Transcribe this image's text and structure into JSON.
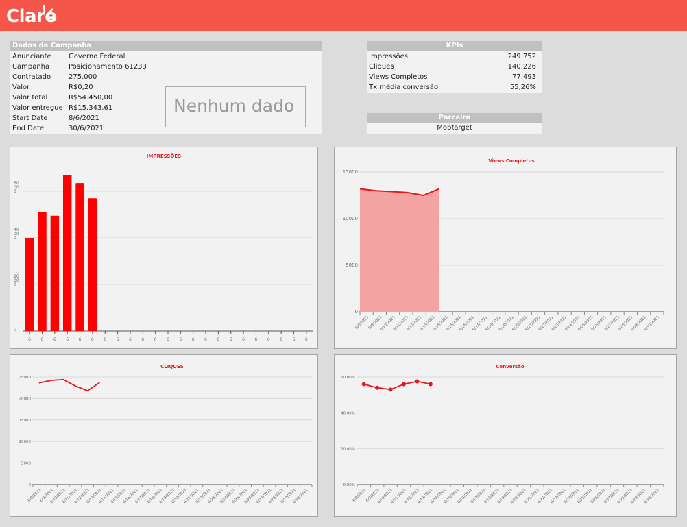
{
  "brand": {
    "name": "Claro",
    "color": "#f4564a"
  },
  "campaign": {
    "title": "Dados da Campanha",
    "rows": [
      {
        "label": "Anunciante",
        "value": "Governo Federal"
      },
      {
        "label": "Campanha",
        "value": "Posicionamento 61233"
      },
      {
        "label": "Contratado",
        "value": "275.000"
      },
      {
        "label": "Valor",
        "value": "R$0,20"
      },
      {
        "label": "Valor total",
        "value": "R$54.450,00"
      },
      {
        "label": "Valor entregue",
        "value": "R$15.343,61"
      },
      {
        "label": "Start Date",
        "value": "8/6/2021"
      },
      {
        "label": "End Date",
        "value": "30/6/2021"
      }
    ],
    "no_data": "Nenhum dado"
  },
  "kpis": {
    "title": "KPIs",
    "rows": [
      {
        "label": "Impressões",
        "value": "249.752"
      },
      {
        "label": "Cliques",
        "value": "140.226"
      },
      {
        "label": "Views Completos",
        "value": "77.493"
      },
      {
        "label": "Tx média conversão",
        "value": "55,26%"
      }
    ]
  },
  "partner": {
    "title": "Parceiro",
    "value": "Mobtarget"
  },
  "chart_data": [
    {
      "type": "bar",
      "title": "IMPRESSÕES",
      "color": "#ff0000",
      "ylim": [
        0,
        7000
      ],
      "ytick_labels": [
        {
          "value": 0,
          "lines": [
            "0"
          ]
        },
        {
          "value": 2000,
          "lines": [
            "20",
            "00",
            "0"
          ]
        },
        {
          "value": 4000,
          "lines": [
            "40",
            "00",
            "0"
          ]
        },
        {
          "value": 6000,
          "lines": [
            "60",
            "00",
            "0"
          ]
        }
      ],
      "n_categories": 23,
      "xtick_text": "6",
      "values": [
        4000,
        5100,
        4950,
        6700,
        6350,
        5700
      ]
    },
    {
      "type": "area",
      "title": "Views Completos",
      "color": "#e8171b",
      "fill": "#f4a3a3",
      "ylim": [
        0,
        15000
      ],
      "yticks": [
        "0",
        "5000",
        "10000",
        "15000"
      ],
      "ytick_values": [
        0,
        5000,
        10000,
        15000
      ],
      "categories": [
        "6/8/2021",
        "6/9/2021",
        "6/10/2021",
        "6/11/2021",
        "6/12/2021",
        "6/13/2021",
        "6/14/2021",
        "6/15/2021",
        "6/16/2021",
        "6/17/2021",
        "6/18/2021",
        "6/19/2021",
        "6/20/2021",
        "6/21/2021",
        "6/22/2021",
        "6/23/2021",
        "6/24/2021",
        "6/25/2021",
        "6/26/2021",
        "6/27/2021",
        "6/28/2021",
        "6/29/2021",
        "6/30/2021"
      ],
      "values": [
        13200,
        13000,
        12900,
        12800,
        12500,
        13200
      ]
    },
    {
      "type": "line",
      "title": "CLIQUES",
      "color": "#e8171b",
      "ylim": [
        0,
        25000
      ],
      "yticks": [
        "0",
        "5000",
        "10000",
        "15000",
        "20000",
        "25000"
      ],
      "ytick_values": [
        0,
        5000,
        10000,
        15000,
        20000,
        25000
      ],
      "categories": [
        "6/8/2021",
        "6/9/2021",
        "6/10/2021",
        "6/11/2021",
        "6/12/2021",
        "6/13/2021",
        "6/14/2021",
        "6/15/2021",
        "6/16/2021",
        "6/17/2021",
        "6/18/2021",
        "6/19/2021",
        "6/20/2021",
        "6/21/2021",
        "6/22/2021",
        "6/23/2021",
        "6/24/2021",
        "6/25/2021",
        "6/26/2021",
        "6/27/2021",
        "6/28/2021",
        "6/29/2021",
        "6/30/2021"
      ],
      "values": [
        23600,
        24200,
        24400,
        22900,
        21800,
        23700
      ]
    },
    {
      "type": "line",
      "title": "Conversão",
      "color": "#e8171b",
      "markers": true,
      "ylim": [
        0,
        0.6
      ],
      "yticks": [
        "0,00%",
        "20,00%",
        "40,00%",
        "60,00%"
      ],
      "ytick_values": [
        0,
        0.2,
        0.4,
        0.6
      ],
      "categories": [
        "6/8/2021",
        "6/9/2021",
        "6/10/2021",
        "6/11/2021",
        "6/12/2021",
        "6/13/2021",
        "6/14/2021",
        "6/15/2021",
        "6/16/2021",
        "6/17/2021",
        "6/18/2021",
        "6/19/2021",
        "6/20/2021",
        "6/21/2021",
        "6/22/2021",
        "6/23/2021",
        "6/24/2021",
        "6/25/2021",
        "6/26/2021",
        "6/27/2021",
        "6/28/2021",
        "6/29/2021",
        "6/30/2021"
      ],
      "values": [
        0.56,
        0.54,
        0.53,
        0.56,
        0.575,
        0.56
      ]
    }
  ]
}
